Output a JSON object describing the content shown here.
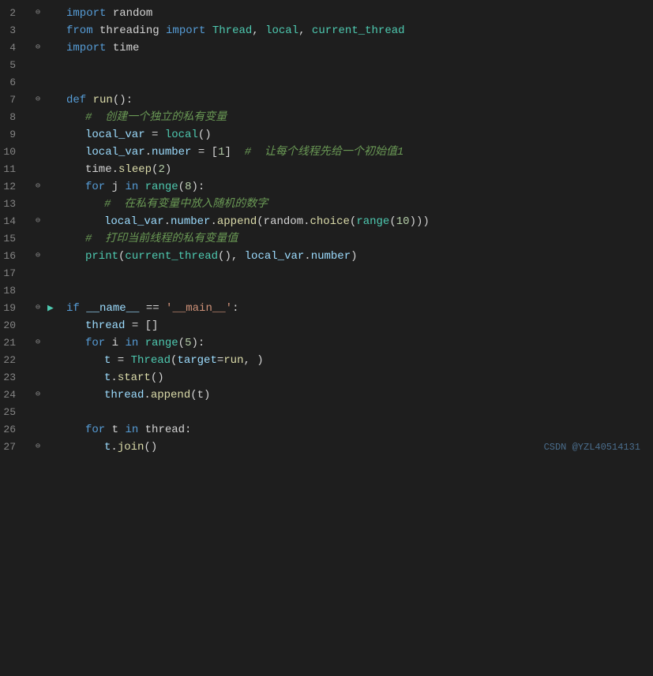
{
  "lines": [
    {
      "num": 2,
      "gutter": "fold",
      "content": "import_random"
    },
    {
      "num": 3,
      "gutter": "none",
      "content": "from_threading"
    },
    {
      "num": 4,
      "gutter": "fold",
      "content": "import_time"
    },
    {
      "num": 5,
      "gutter": "none",
      "content": ""
    },
    {
      "num": 6,
      "gutter": "none",
      "content": ""
    },
    {
      "num": 7,
      "gutter": "fold",
      "content": "def_run"
    },
    {
      "num": 8,
      "gutter": "none",
      "content": "comment_create"
    },
    {
      "num": 9,
      "gutter": "none",
      "content": "local_var_assign"
    },
    {
      "num": 10,
      "gutter": "none",
      "content": "local_var_number"
    },
    {
      "num": 11,
      "gutter": "none",
      "content": "time_sleep"
    },
    {
      "num": 12,
      "gutter": "fold",
      "content": "for_j"
    },
    {
      "num": 13,
      "gutter": "none",
      "content": "comment_put"
    },
    {
      "num": 14,
      "gutter": "fold",
      "content": "append_random"
    },
    {
      "num": 15,
      "gutter": "none",
      "content": "comment_print"
    },
    {
      "num": 16,
      "gutter": "fold",
      "content": "print_current"
    },
    {
      "num": 17,
      "gutter": "none",
      "content": ""
    },
    {
      "num": 18,
      "gutter": "none",
      "content": ""
    },
    {
      "num": 19,
      "gutter": "run",
      "content": "if_main"
    },
    {
      "num": 20,
      "gutter": "none",
      "content": "thread_assign"
    },
    {
      "num": 21,
      "gutter": "fold",
      "content": "for_i"
    },
    {
      "num": 22,
      "gutter": "none",
      "content": "t_assign"
    },
    {
      "num": 23,
      "gutter": "none",
      "content": "t_start"
    },
    {
      "num": 24,
      "gutter": "fold",
      "content": "thread_append"
    },
    {
      "num": 25,
      "gutter": "none",
      "content": ""
    },
    {
      "num": 26,
      "gutter": "none",
      "content": "for_t"
    },
    {
      "num": 27,
      "gutter": "fold",
      "content": "t_join"
    }
  ],
  "watermark": "CSDN @YZL40514131"
}
